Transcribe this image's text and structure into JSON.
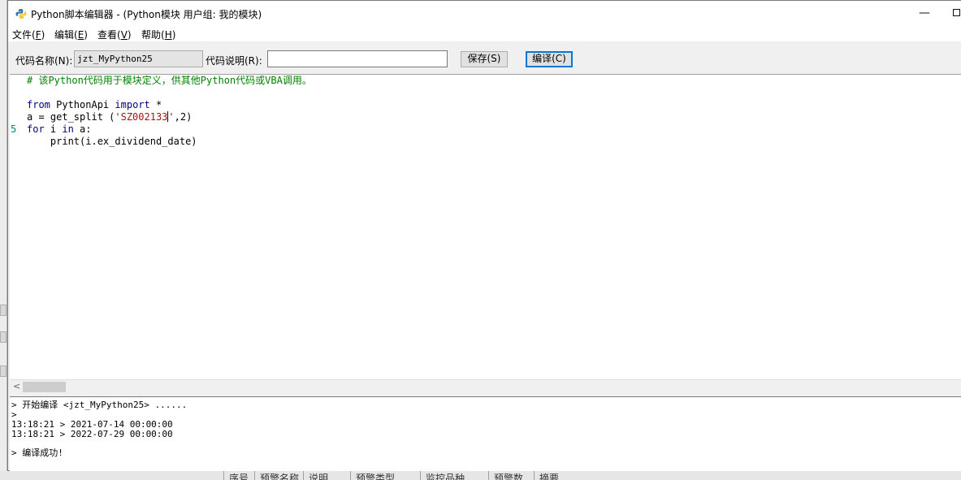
{
  "window": {
    "title": "Python脚本编辑器 - (Python模块 用户组: 我的模块)",
    "minimize": "—"
  },
  "menu": [
    {
      "text": "文件(",
      "key": "F",
      "end": ")"
    },
    {
      "text": "编辑(",
      "key": "E",
      "end": ")"
    },
    {
      "text": "查看(",
      "key": "V",
      "end": ")"
    },
    {
      "text": "帮助(",
      "key": "H",
      "end": ")"
    }
  ],
  "toolbar": {
    "name_label": "代码名称(N):",
    "name_value": "jzt_MyPython25",
    "desc_label": "代码说明(R):",
    "desc_value": "",
    "save_label": "保存(S)",
    "compile_label": "编译(C)"
  },
  "editor": {
    "line_number_shown": "5",
    "line1": "# 该Python代码用于模块定义，供其他Python代码或VBA调用。",
    "line3_kw1": "from",
    "line3_mid": " PythonApi ",
    "line3_kw2": "import",
    "line3_end": " *",
    "line4_start": "a = get_split (",
    "line4_str": "'SZ002133",
    "line4_str_end": "'",
    "line4_end": ",2)",
    "line5_kw1": "for",
    "line5_mid": " i ",
    "line5_kw2": "in",
    "line5_end": " a:",
    "line6": "    print(i.ex_dividend_date)"
  },
  "scrollbar": {
    "arrow": "<"
  },
  "output": {
    "lines": [
      "> 开始编译 <jzt_MyPython25> ......",
      ">",
      "13:18:21 > 2021-07-14 00:00:00",
      "13:18:21 > 2022-07-29 00:00:00",
      "",
      "> 编译成功!"
    ]
  },
  "background_table": {
    "columns": [
      "序号",
      "预警名称",
      "说明",
      "预警类型",
      "监控品种",
      "预警数",
      "摘要"
    ]
  }
}
